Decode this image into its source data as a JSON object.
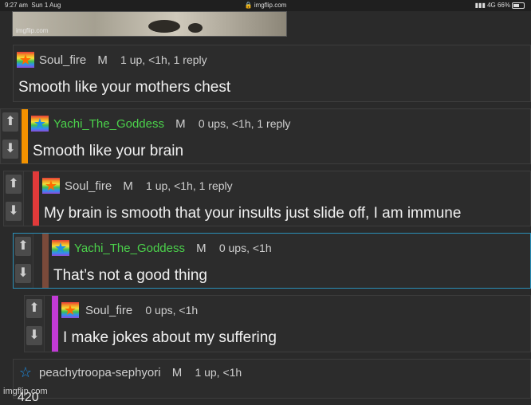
{
  "status_bar": {
    "time": "9:27 am",
    "date": "Sun 1 Aug",
    "url": "imgflip.com",
    "signal": "4G",
    "battery": "66%"
  },
  "top_image": {
    "watermark": "imgflip.com"
  },
  "comments": [
    {
      "user": "Soul_fire",
      "badge": "M",
      "stats": "1 up, <1h, 1 reply",
      "text": "Smooth like your mothers chest",
      "star": "★",
      "star_color": "#ff6a00",
      "user_color": "#cfcfcf"
    },
    {
      "user": "Yachi_The_Goddess",
      "badge": "M",
      "stats": "0 ups, <1h, 1 reply",
      "text": "Smooth like your brain",
      "star": "★",
      "star_color": "#1d8fe8",
      "user_color": "#4bd24b",
      "accent": "#f39200"
    },
    {
      "user": "Soul_fire",
      "badge": "M",
      "stats": "1 up, <1h, 1 reply",
      "text": "My brain is smooth that your insults just slide off, I am immune",
      "star": "★",
      "star_color": "#ff6a00",
      "user_color": "#cfcfcf",
      "accent": "#e13a3a"
    },
    {
      "user": "Yachi_The_Goddess",
      "badge": "M",
      "stats": "0 ups, <1h",
      "text": "That’s not a good thing",
      "star": "★",
      "star_color": "#1d8fe8",
      "user_color": "#4bd24b",
      "accent": "#7a4a3a"
    },
    {
      "user": "Soul_fire",
      "badge": "",
      "stats": "0 ups, <1h",
      "text": "I make jokes about my suffering",
      "star": "★",
      "star_color": "#ff6a00",
      "user_color": "#cfcfcf",
      "accent": "#c23ad6"
    },
    {
      "user": "peachytroopa-sephyori",
      "badge": "M",
      "stats": "1 up, <1h",
      "text": "420",
      "star": "☆",
      "star_color": "#1d8fe8",
      "user_color": "#cfcfcf"
    }
  ],
  "icons": {
    "upvote": "arrow-up-icon",
    "downvote": "arrow-down-icon"
  },
  "footer": {
    "watermark": "imgflip.com"
  }
}
